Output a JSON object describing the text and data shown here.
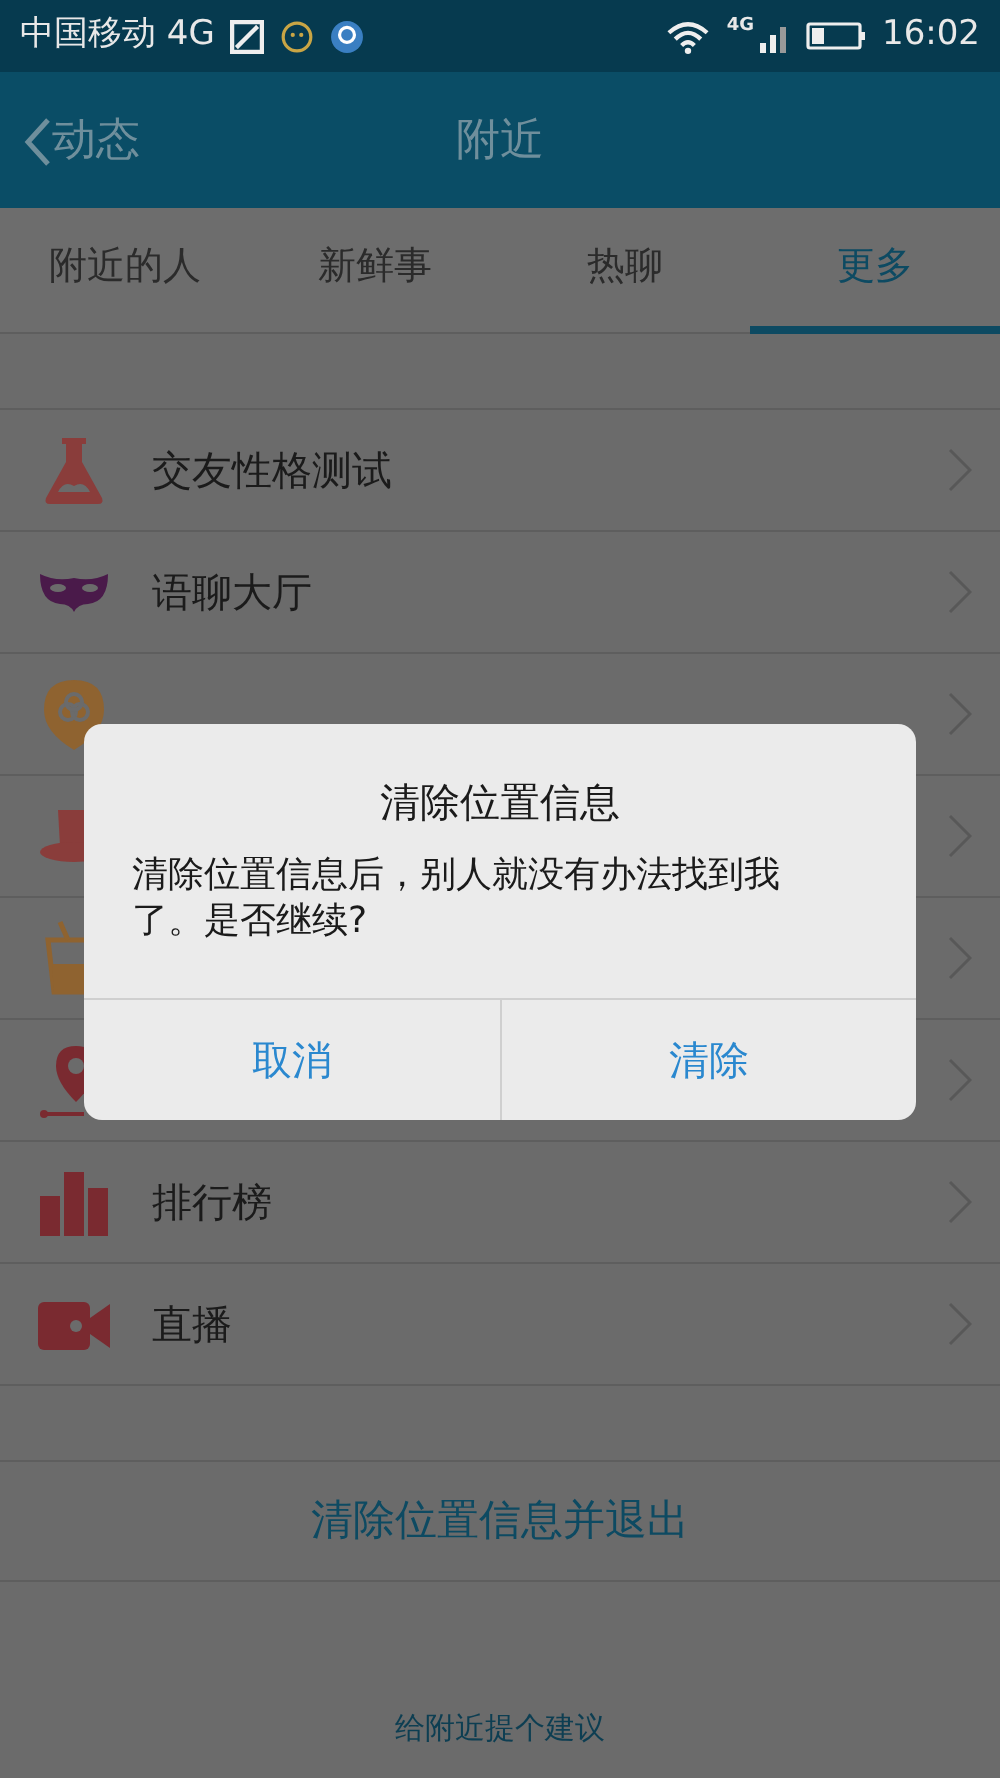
{
  "status_bar": {
    "carrier": "中国移动 4G",
    "network": "4G",
    "time": "16:02"
  },
  "header": {
    "back": "动态",
    "title": "附近"
  },
  "tabs": [
    {
      "label": "附近的人",
      "selected": false
    },
    {
      "label": "新鲜事",
      "selected": false
    },
    {
      "label": "热聊",
      "selected": false
    },
    {
      "label": "更多",
      "selected": true
    }
  ],
  "menu_items_top": [
    {
      "label": "交友性格测试"
    },
    {
      "label": "语聊大厅"
    }
  ],
  "menu_items_bottom": [
    {
      "label": "排行榜"
    },
    {
      "label": "直播"
    }
  ],
  "exit_button": "清除位置信息并退出",
  "feedback_link": "给附近提个建议",
  "dialog": {
    "title": "清除位置信息",
    "message": "清除位置信息后，别人就没有办法找到我了。是否继续?",
    "buttons": [
      "取消",
      "清除"
    ]
  }
}
